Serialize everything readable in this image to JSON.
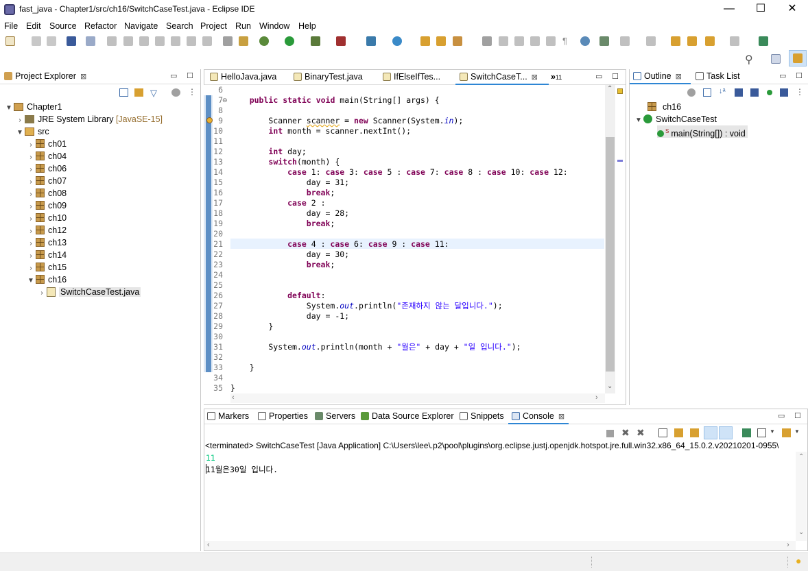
{
  "window": {
    "title": "fast_java - Chapter1/src/ch16/SwitchCaseTest.java - Eclipse IDE",
    "minimize": "—",
    "maximize": "☐",
    "close": "✕"
  },
  "menu": [
    "File",
    "Edit",
    "Source",
    "Refactor",
    "Navigate",
    "Search",
    "Project",
    "Run",
    "Window",
    "Help"
  ],
  "project_explorer": {
    "tab_label": "Project Explorer",
    "tree": {
      "project": "Chapter1",
      "jre_label": "JRE System Library",
      "jre_version": "[JavaSE-15]",
      "src": "src",
      "packages": [
        "ch01",
        "ch04",
        "ch06",
        "ch07",
        "ch08",
        "ch09",
        "ch10",
        "ch12",
        "ch13",
        "ch14",
        "ch15",
        "ch16"
      ],
      "file": "SwitchCaseTest.java"
    }
  },
  "editor": {
    "tabs": [
      {
        "label": "HelloJava.java"
      },
      {
        "label": "BinaryTest.java"
      },
      {
        "label": "IfElseIfTes..."
      },
      {
        "label": "SwitchCaseT..."
      }
    ],
    "overflow_label": "»",
    "overflow_count": "11",
    "lines": [
      {
        "n": "6",
        "code": ""
      },
      {
        "n": "7",
        "code": "    public static void main(String[] args) {"
      },
      {
        "n": "8",
        "code": ""
      },
      {
        "n": "9",
        "code": "        Scanner scanner = new Scanner(System.in);"
      },
      {
        "n": "10",
        "code": "        int month = scanner.nextInt();"
      },
      {
        "n": "11",
        "code": ""
      },
      {
        "n": "12",
        "code": "        int day;"
      },
      {
        "n": "13",
        "code": "        switch(month) {"
      },
      {
        "n": "14",
        "code": "            case 1: case 3: case 5 : case 7: case 8 : case 10: case 12:"
      },
      {
        "n": "15",
        "code": "                day = 31;"
      },
      {
        "n": "16",
        "code": "                break;"
      },
      {
        "n": "17",
        "code": "            case 2 :"
      },
      {
        "n": "18",
        "code": "                day = 28;"
      },
      {
        "n": "19",
        "code": "                break;"
      },
      {
        "n": "20",
        "code": ""
      },
      {
        "n": "21",
        "code": "            case 4 : case 6: case 9 : case 11:"
      },
      {
        "n": "22",
        "code": "                day = 30;"
      },
      {
        "n": "23",
        "code": "                break;"
      },
      {
        "n": "24",
        "code": ""
      },
      {
        "n": "25",
        "code": ""
      },
      {
        "n": "26",
        "code": "            default:"
      },
      {
        "n": "27",
        "code": "                System.out.println(\"존재하지 않는 달입니다.\");"
      },
      {
        "n": "28",
        "code": "                day = -1;"
      },
      {
        "n": "29",
        "code": "        }"
      },
      {
        "n": "30",
        "code": ""
      },
      {
        "n": "31",
        "code": "        System.out.println(month + \"월은\" + day + \"일 입니다.\");"
      },
      {
        "n": "32",
        "code": ""
      },
      {
        "n": "33",
        "code": "    }"
      },
      {
        "n": "34",
        "code": ""
      },
      {
        "n": "35",
        "code": "}"
      }
    ]
  },
  "outline": {
    "tab_label": "Outline",
    "task_tab_label": "Task List",
    "package": "ch16",
    "class": "SwitchCaseTest",
    "method": "main(String[]) : void",
    "static_marker": "S"
  },
  "bottom": {
    "tabs": [
      "Markers",
      "Properties",
      "Servers",
      "Data Source Explorer",
      "Snippets",
      "Console"
    ],
    "console_header": "<terminated> SwitchCaseTest [Java Application] C:\\Users\\lee\\.p2\\pool\\plugins\\org.eclipse.justj.openjdk.hotspot.jre.full.win32.x86_64_15.0.2.v20210201-0955\\",
    "input_line": "11",
    "output_line": "11월은30일 입니다."
  },
  "colors": {
    "keyword": "#7f0055",
    "string": "#2a00ff",
    "field": "#0000c0",
    "input": "#00c87d",
    "current_line": "#e8f2fe"
  }
}
